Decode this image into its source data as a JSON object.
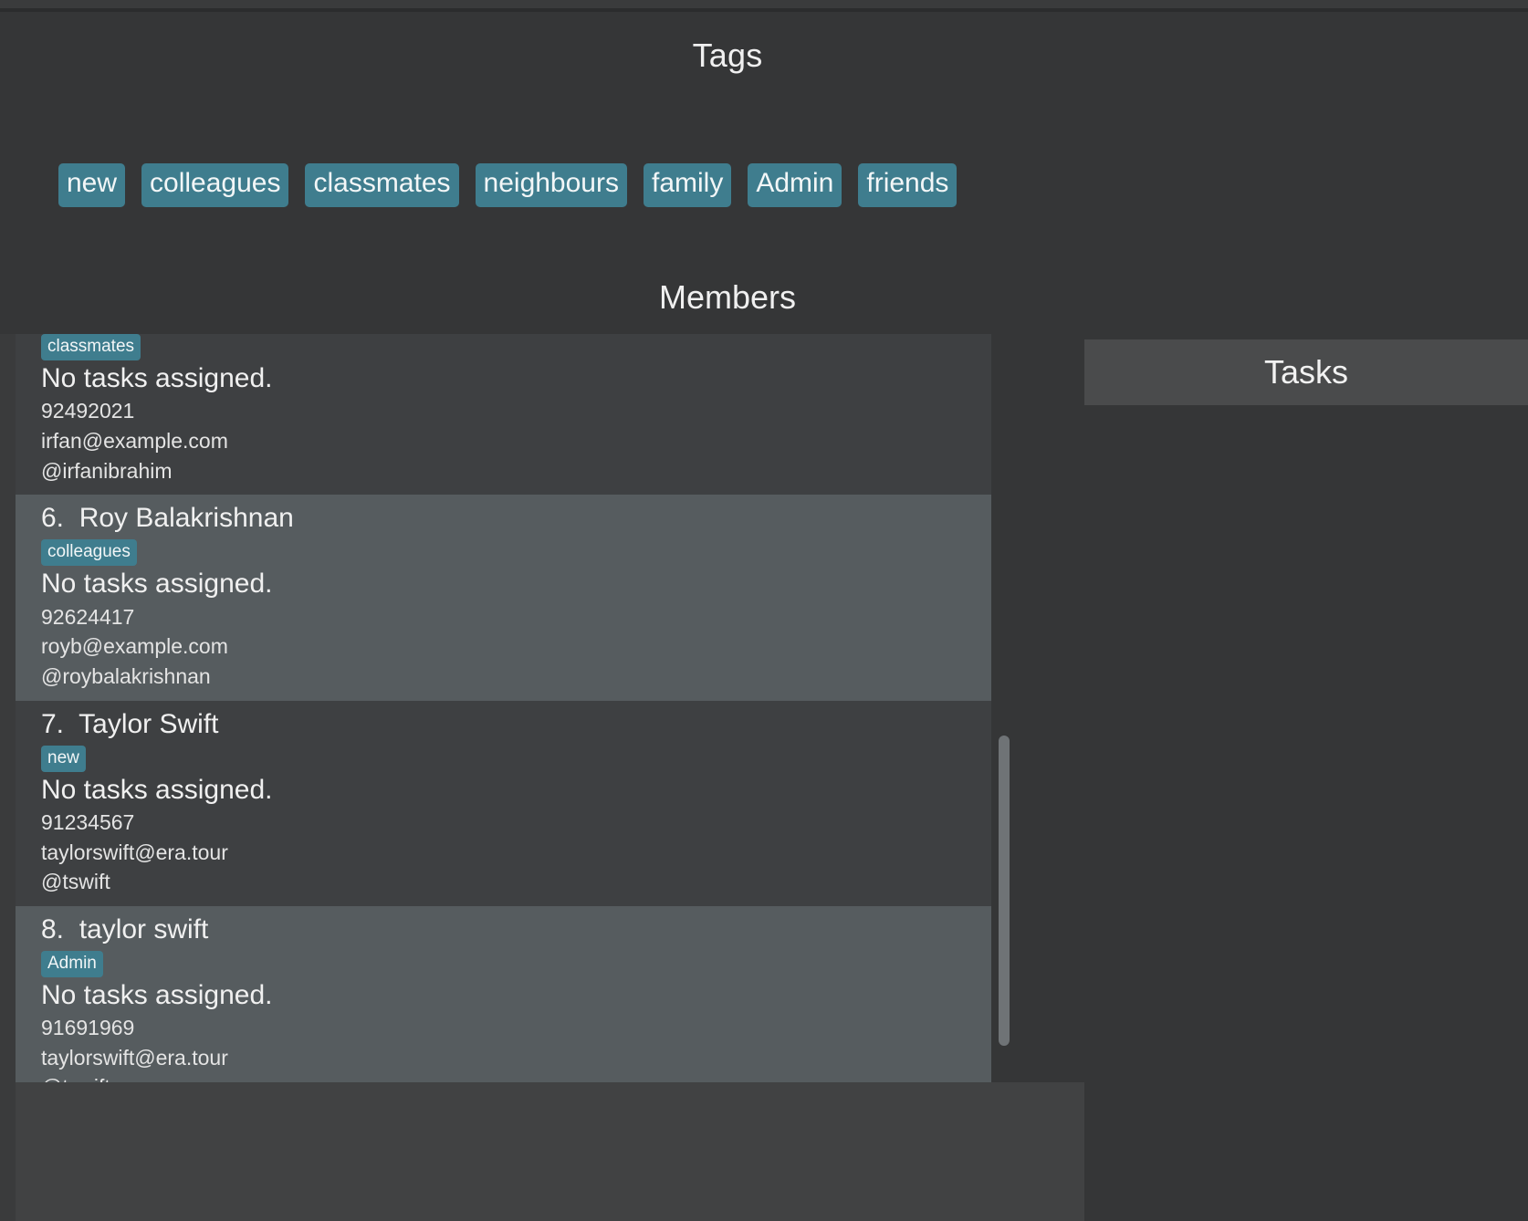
{
  "window": {
    "background_color": "#353637",
    "accent_color": "#3f7d8e"
  },
  "tags_section": {
    "title": "Tags",
    "chips": [
      {
        "label": "new"
      },
      {
        "label": "colleagues"
      },
      {
        "label": "classmates"
      },
      {
        "label": "neighbours"
      },
      {
        "label": "family"
      },
      {
        "label": "Admin"
      },
      {
        "label": "friends"
      }
    ]
  },
  "members_section": {
    "title": "Members",
    "rows": [
      {
        "index": "",
        "name": "",
        "tag": "classmates",
        "tasks": "No tasks assigned.",
        "phone": "92492021",
        "email": "irfan@example.com",
        "handle": "@irfanibrahim",
        "stripe": "dark",
        "clipped": true
      },
      {
        "index": "6.",
        "name": "6.  Roy Balakrishnan",
        "tag": "colleagues",
        "tasks": "No tasks assigned.",
        "phone": "92624417",
        "email": "royb@example.com",
        "handle": "@roybalakrishnan",
        "stripe": "light",
        "clipped": false
      },
      {
        "index": "7.",
        "name": "7.  Taylor Swift",
        "tag": "new",
        "tasks": "No tasks assigned.",
        "phone": "91234567",
        "email": "taylorswift@era.tour",
        "handle": "@tswift",
        "stripe": "dark",
        "clipped": false
      },
      {
        "index": "8.",
        "name": "8.  taylor swift",
        "tag": "Admin",
        "tasks": "No tasks assigned.",
        "phone": "91691969",
        "email": "taylorswift@era.tour",
        "handle": "@tswift",
        "stripe": "light",
        "clipped": false
      }
    ],
    "scrollbar": {
      "name": "members-vertical-scrollbar"
    }
  },
  "tasks_section": {
    "title": "Tasks",
    "items": []
  }
}
